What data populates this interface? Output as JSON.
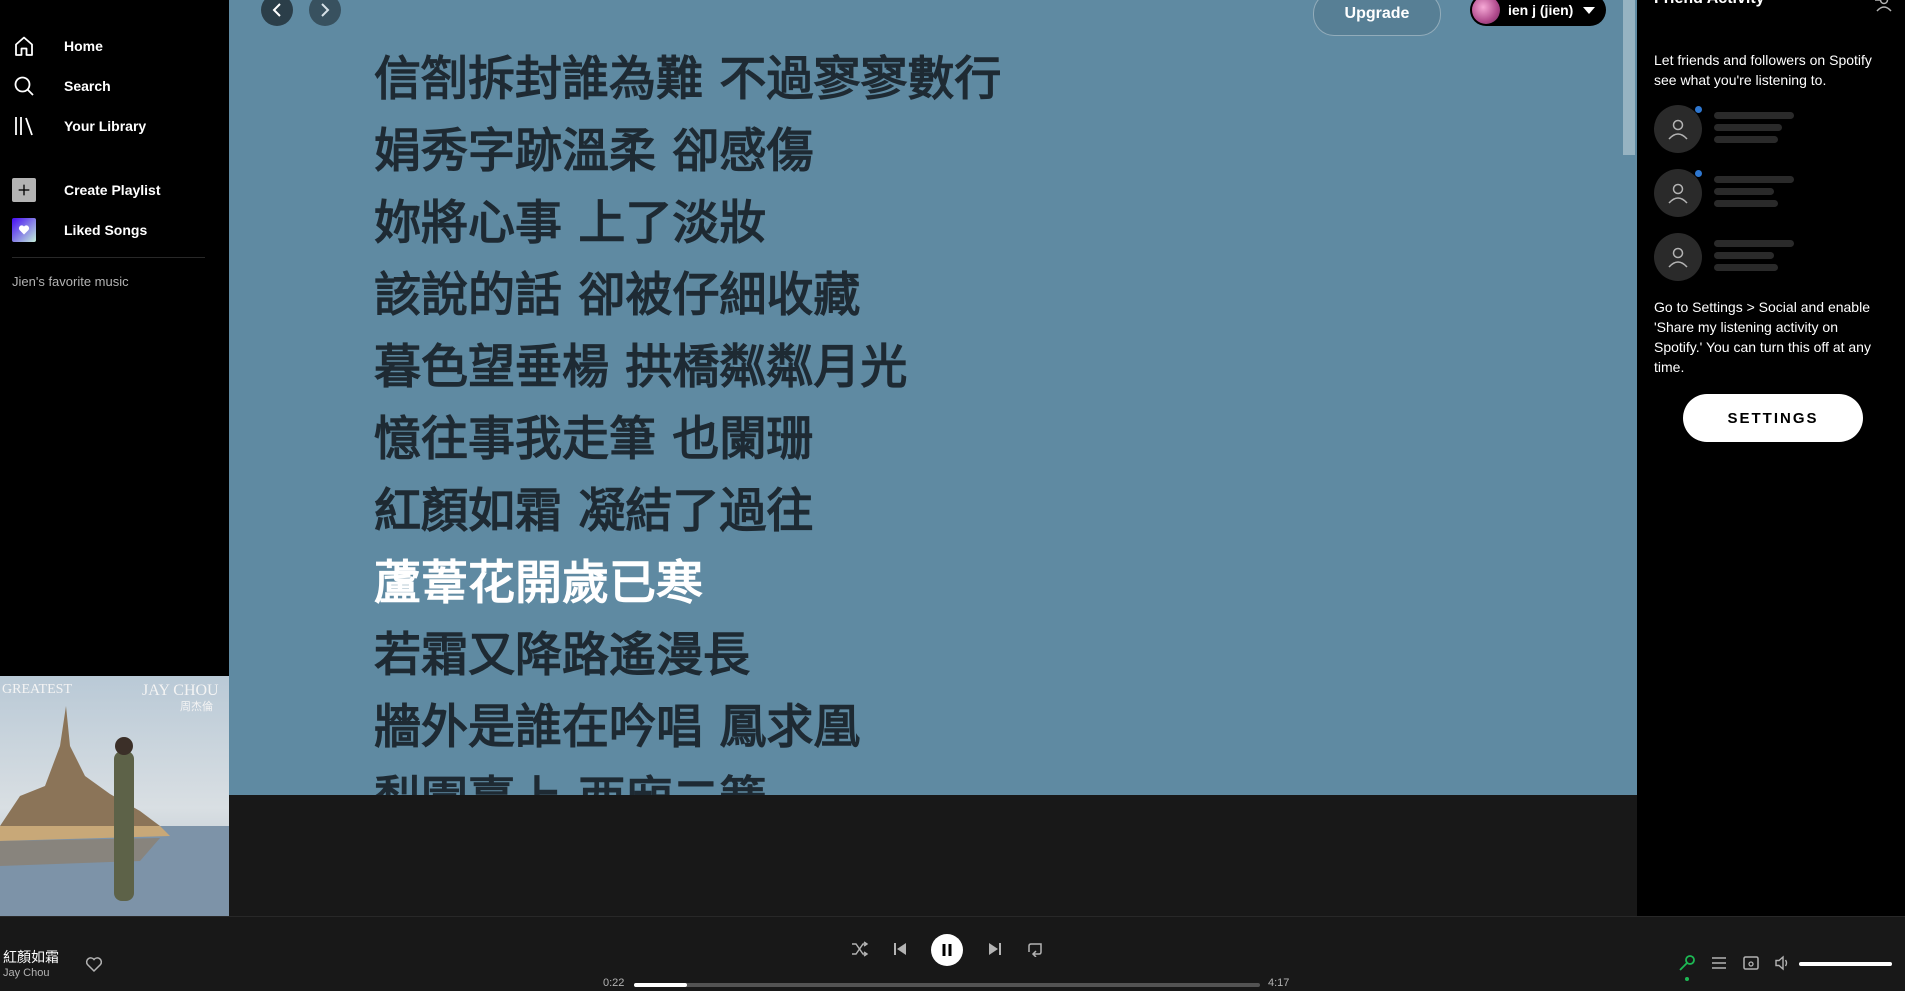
{
  "sidebar": {
    "items": [
      {
        "label": "Home",
        "icon": "home-icon"
      },
      {
        "label": "Search",
        "icon": "search-icon"
      },
      {
        "label": "Your Library",
        "icon": "library-icon"
      }
    ],
    "create_playlist": "Create Playlist",
    "liked_songs": "Liked Songs",
    "playlists": [
      "Jien's favorite music"
    ]
  },
  "cover": {
    "left_text": "GREATEST",
    "right_text": "JAY CHOU",
    "right_sub": "周杰倫"
  },
  "header": {
    "upgrade_label": "Upgrade",
    "user_name": "ien j (jien)"
  },
  "lyrics": {
    "lines": [
      "信劄拆封誰為難 不過寥寥數行",
      "娟秀字跡溫柔 卻感傷",
      "妳將心事 上了淡妝",
      "該說的話 卻被仔細收藏",
      "暮色望垂楊 拱橋粼粼月光",
      "憶往事我走筆 也闌珊",
      "紅顏如霜 凝結了過往",
      "蘆葦花開歲已寒",
      "若霜又降路遙漫長",
      "牆外是誰在吟唱 鳳求凰",
      "梨園臺上 西廂二簧"
    ],
    "current_index": 7
  },
  "friends": {
    "title": "Friend Activity",
    "description": "Let friends and followers on Spotify see what you're listening to.",
    "info": "Go to Settings > Social and enable 'Share my listening activity on Spotify.' You can turn this off at any time.",
    "settings_label": "SETTINGS"
  },
  "player": {
    "track_title": "紅顏如霜",
    "track_artist": "Jay Chou",
    "time_elapsed": "0:22",
    "time_total": "4:17",
    "progress": 0.085,
    "volume": 1.0
  },
  "colors": {
    "lyrics_background": "#5f8aa2",
    "lyrics_text": "#1e2a33",
    "accent_green": "#1db954",
    "friend_dot": "#2e77d0"
  }
}
